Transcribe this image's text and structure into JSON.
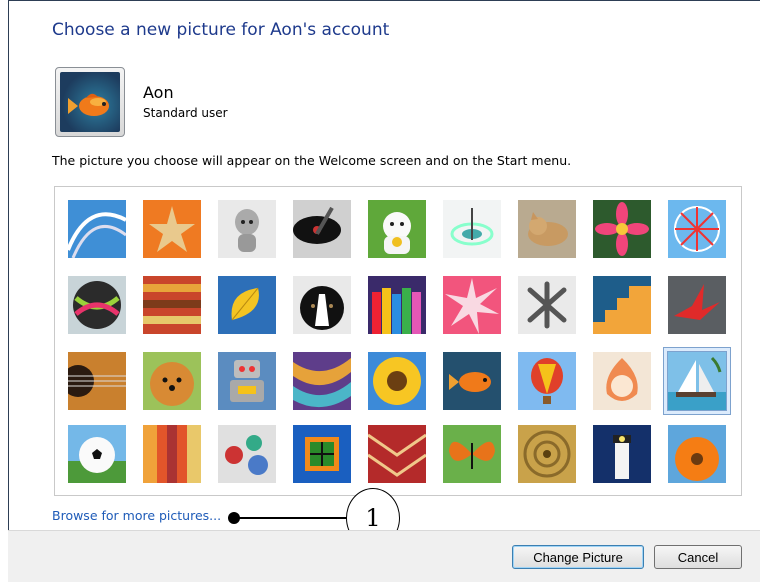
{
  "dialog": {
    "title": "Choose a new picture for Aon's account",
    "description": "The picture you choose will appear on the Welcome screen and on the Start menu."
  },
  "user": {
    "name": "Aon",
    "role": "Standard user",
    "avatar_icon": "fish-icon"
  },
  "gallery": {
    "selected": "sailboat-picture",
    "pictures": [
      "roller-coaster-picture",
      "starfish-picture",
      "robot-dog-picture",
      "turntable-picture",
      "lucky-cat-picture",
      "spinning-top-picture",
      "kitten-picture",
      "flower-picture",
      "ferris-wheel-picture",
      "ball-picture",
      "fabric-picture",
      "leaf-picture",
      "dog-picture",
      "crayons-picture",
      "star-picture",
      "jacks-picture",
      "stairs-picture",
      "origami-crane-picture",
      "guitar-picture",
      "pomeranian-picture",
      "toy-robot-picture",
      "scarves-picture",
      "sunflower-picture",
      "fish-picture",
      "hot-air-balloon-picture",
      "doll-picture",
      "sailboat-picture",
      "soccer-ball-picture",
      "textile-picture",
      "marbles-picture",
      "window-picture",
      "tapestry-picture",
      "butterfly-picture",
      "basket-picture",
      "lighthouse-picture",
      "gerbera-picture"
    ]
  },
  "links": {
    "browse": "Browse for more pictures..."
  },
  "annotation": {
    "marker": "1"
  },
  "buttons": {
    "change_picture": "Change Picture",
    "cancel": "Cancel"
  },
  "colors": {
    "title": "#1e3a8c",
    "link": "#1e5bb8",
    "selection": "#7da2ce"
  }
}
